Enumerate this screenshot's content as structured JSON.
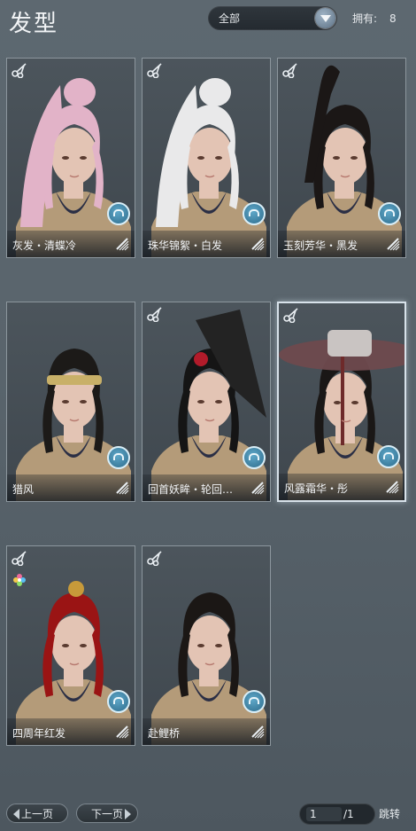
{
  "header": {
    "title": "发型",
    "filter_value": "全部",
    "owned_label": "拥有:",
    "owned_count": "8"
  },
  "hairstyles": [
    {
      "name": "灰发・清蝶冷",
      "hair_color": "#e2b3c8",
      "selected": false,
      "badge": "comb-icon"
    },
    {
      "name": "珠华锦絮・白发",
      "hair_color": "#e9e9ea",
      "selected": false,
      "badge": "comb-icon"
    },
    {
      "name": "玉刻芳华・黑发",
      "hair_color": "#1b1716",
      "selected": false,
      "badge": "comb-icon"
    },
    {
      "name": "猎风",
      "hair_color": "#1c1a18",
      "selected": false,
      "badge": "comb-icon"
    },
    {
      "name": "回首妖眸・轮回…",
      "hair_color": "#151515",
      "selected": false,
      "badge": "comb-icon"
    },
    {
      "name": "风露霜华・彤",
      "hair_color": "#1a1716",
      "selected": true,
      "badge": "comb-icon"
    },
    {
      "name": "四周年红发",
      "hair_color": "#9a1414",
      "selected": false,
      "badge": "comb-icon"
    },
    {
      "name": "赴鲤桥",
      "hair_color": "#1b1715",
      "selected": false,
      "badge": "comb-icon"
    }
  ],
  "pager": {
    "prev_label": "上一页",
    "next_label": "下一页",
    "current_page": "1",
    "total_pages": "/1",
    "jump_label": "跳转"
  }
}
